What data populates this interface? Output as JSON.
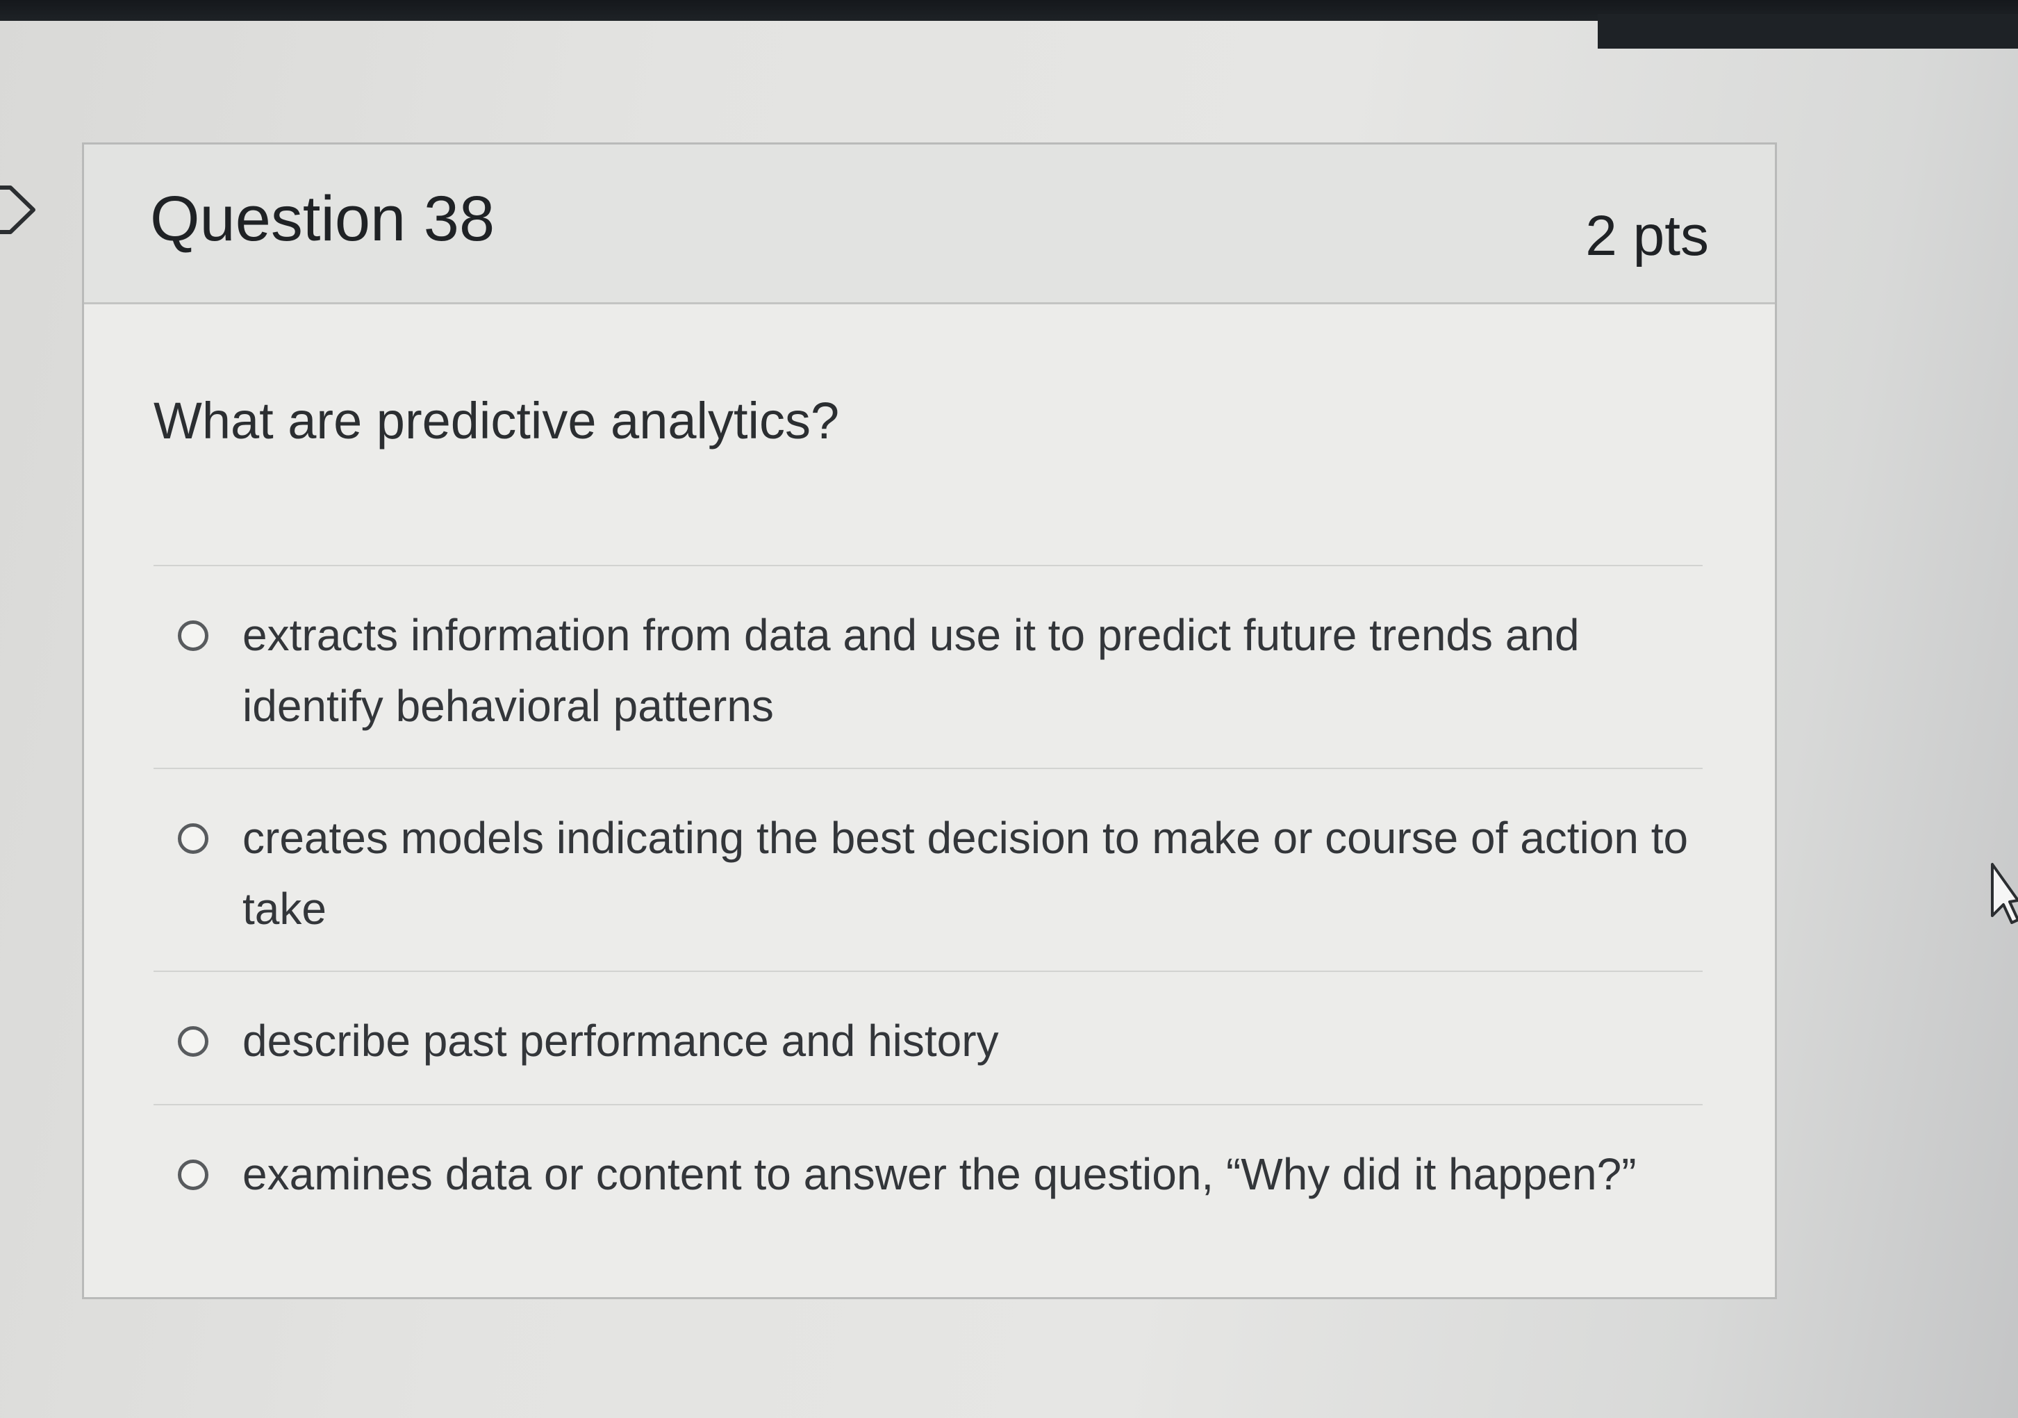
{
  "question": {
    "title": "Question 38",
    "points": "2 pts",
    "text": "What are predictive analytics?"
  },
  "answers": [
    {
      "label": "extracts information from data and use it to predict future trends and identify behavioral patterns"
    },
    {
      "label": "creates models indicating the best decision to make or course of action to take"
    },
    {
      "label": "describe past performance and history"
    },
    {
      "label": "examines data or content to answer the question, “Why did it happen?”"
    }
  ],
  "icons": {
    "flag": "bookmark-flag-icon",
    "radio": "radio-button-icon",
    "cursor": "mouse-cursor-icon"
  },
  "colors": {
    "card_background": "#ececea",
    "header_background": "#e2e3e1",
    "text": "#1f2225",
    "border": "#b9bab9"
  }
}
